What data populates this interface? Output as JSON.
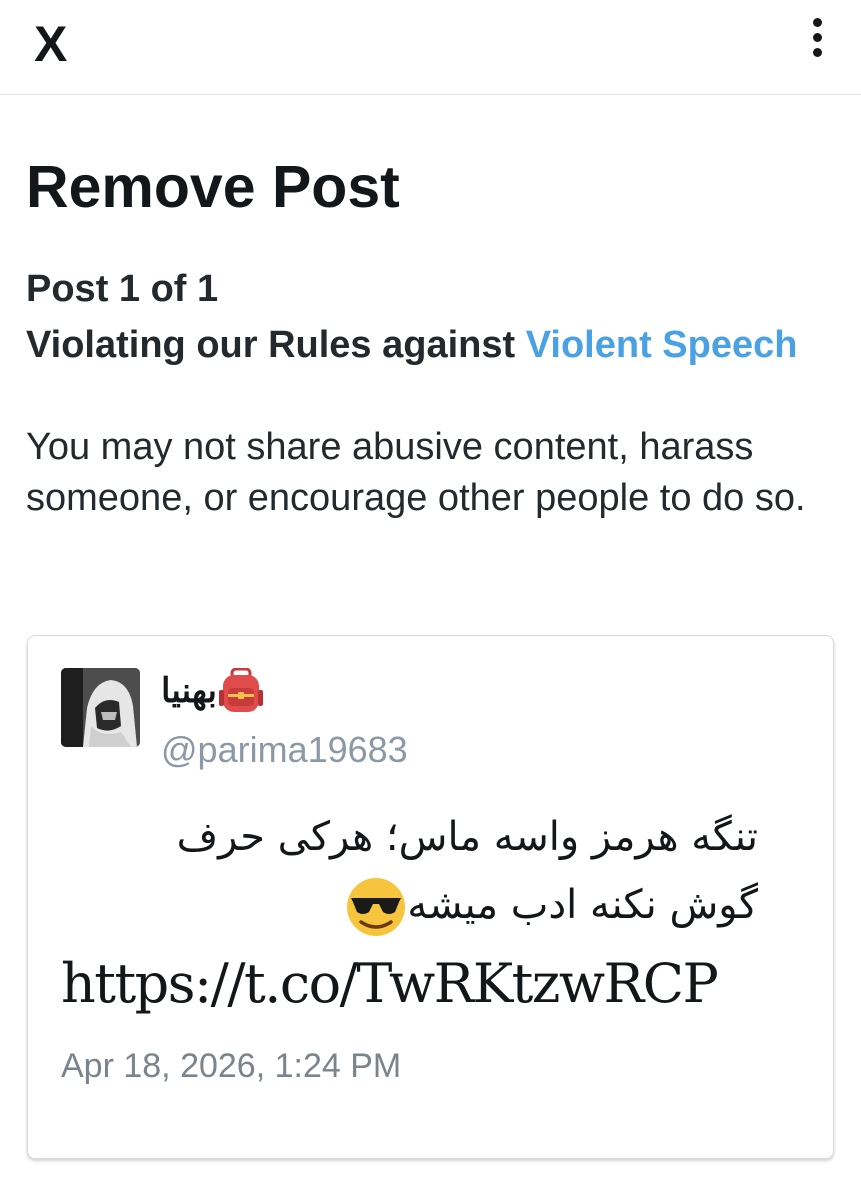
{
  "header": {
    "close_label": "X",
    "more_icon": "more-vertical-icon"
  },
  "page": {
    "title": "Remove Post",
    "post_count": "Post 1 of 1",
    "violation_prefix": "Violating our Rules against",
    "violation_link": "Violent Speech",
    "rule_description": "You may not share abusive content, harass someone, or encourage other people to do so."
  },
  "post": {
    "display_name": "بهنیا",
    "name_emoji": "backpack-icon",
    "handle": "@parima19683",
    "text_line_1": "تنگه هرمز واسه ماس؛ هرکی حرف",
    "text_line_2": "گوش نکنه ادب میشه",
    "text_emoji": "smiling-face-with-sunglasses-icon",
    "link": "https://t.co/TwRKtzwRCP",
    "date": "Apr 18, 2026, 1:24 PM"
  },
  "colors": {
    "link_blue": "#4aa1e4",
    "text_dark": "#14171a",
    "muted_gray": "#8b98a5",
    "card_border": "#d7dadd"
  }
}
